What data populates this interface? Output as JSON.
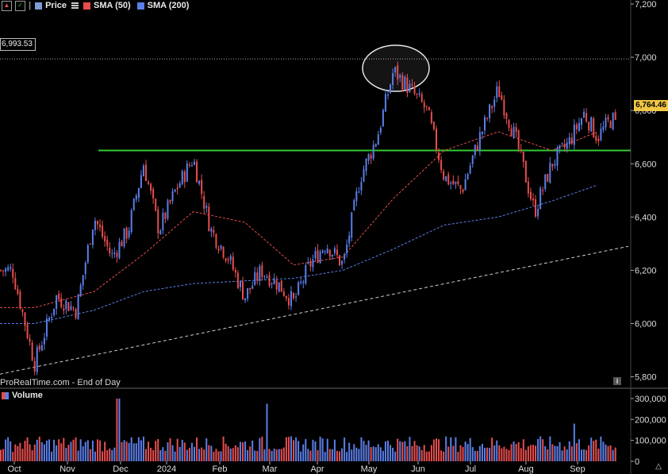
{
  "legend": {
    "price_label": "Price",
    "sma50_label": "SMA (50)",
    "sma200_label": "SMA (200)",
    "price_color": "#d0d0d0",
    "sma50_color": "#e84d4d",
    "sma200_color": "#5b7fe8"
  },
  "tags": {
    "hline_value": "6,993.53",
    "last_price": "6,764.46"
  },
  "source_text": "ProRealTime.com - End of Day",
  "volume_label": "Volume",
  "colors": {
    "up": "#5b7fe8",
    "down": "#e84d4d",
    "support": "#32c832",
    "trend": "#cccccc",
    "axis_text": "#dddddd"
  },
  "chart_data": [
    {
      "type": "candlestick",
      "x_axis_labels": [
        "Oct",
        "Nov",
        "Dec",
        "2024",
        "Feb",
        "Mar",
        "Apr",
        "May",
        "Jun",
        "Jul",
        "Aug",
        "Sep"
      ],
      "y_ticks": [
        "7,200",
        "7,000",
        "6,800",
        "6,600",
        "6,400",
        "6,200",
        "6,000",
        "5,800"
      ],
      "ylim": [
        5760,
        7200
      ],
      "support_level": 6650,
      "reference_level": 6993.53,
      "last_value": 6764.46,
      "highlight": "ellipse around the May highs",
      "trendline": {
        "start": [
          "Oct",
          5810
        ],
        "end": [
          "Sep",
          6290
        ]
      },
      "price_path": [
        [
          "Oct",
          6200
        ],
        [
          "Oct",
          5850
        ],
        [
          "Oct",
          6100
        ],
        [
          "Nov",
          6050
        ],
        [
          "Nov",
          6400
        ],
        [
          "Nov",
          6250
        ],
        [
          "Dec",
          6350
        ],
        [
          "Dec",
          6600
        ],
        [
          "Dec",
          6350
        ],
        [
          "2024",
          6500
        ],
        [
          "2024",
          6620
        ],
        [
          "2024",
          6350
        ],
        [
          "Feb",
          6250
        ],
        [
          "Feb",
          6100
        ],
        [
          "Feb",
          6200
        ],
        [
          "Mar",
          6150
        ],
        [
          "Mar",
          6080
        ],
        [
          "Mar",
          6220
        ],
        [
          "Apr",
          6300
        ],
        [
          "Apr",
          6220
        ],
        [
          "Apr",
          6550
        ],
        [
          "May",
          6700
        ],
        [
          "May",
          6950
        ],
        [
          "May",
          6880
        ],
        [
          "Jun",
          6800
        ],
        [
          "Jun",
          6550
        ],
        [
          "Jun",
          6500
        ],
        [
          "Jul",
          6700
        ],
        [
          "Jul",
          6880
        ],
        [
          "Jul",
          6680
        ],
        [
          "Aug",
          6420
        ],
        [
          "Aug",
          6600
        ],
        [
          "Aug",
          6680
        ],
        [
          "Sep",
          6790
        ],
        [
          "Sep",
          6700
        ],
        [
          "Sep",
          6764.46
        ]
      ],
      "sma50_path": [
        [
          "Oct",
          6060
        ],
        [
          "Nov",
          6120
        ],
        [
          "Dec",
          6260
        ],
        [
          "2024",
          6420
        ],
        [
          "Feb",
          6380
        ],
        [
          "Mar",
          6220
        ],
        [
          "Apr",
          6250
        ],
        [
          "May",
          6470
        ],
        [
          "Jun",
          6650
        ],
        [
          "Jul",
          6720
        ],
        [
          "Aug",
          6650
        ],
        [
          "Sep",
          6720
        ]
      ],
      "sma200_path": [
        [
          "Oct",
          6000
        ],
        [
          "Nov",
          6050
        ],
        [
          "Dec",
          6120
        ],
        [
          "2024",
          6150
        ],
        [
          "Feb",
          6160
        ],
        [
          "Mar",
          6170
        ],
        [
          "Apr",
          6200
        ],
        [
          "May",
          6280
        ],
        [
          "Jun",
          6370
        ],
        [
          "Jul",
          6400
        ],
        [
          "Aug",
          6460
        ],
        [
          "Sep",
          6520
        ]
      ]
    },
    {
      "type": "bar",
      "title": "Volume",
      "y_ticks": [
        "300,000",
        "200,000",
        "100,000",
        "0"
      ],
      "ylim": [
        0,
        330000
      ],
      "typical_volume": 100000,
      "peaks": [
        {
          "month": "Dec",
          "value": 300000
        },
        {
          "month": "Mar",
          "value": 275000
        },
        {
          "month": "Sep",
          "value": 180000
        }
      ]
    }
  ]
}
